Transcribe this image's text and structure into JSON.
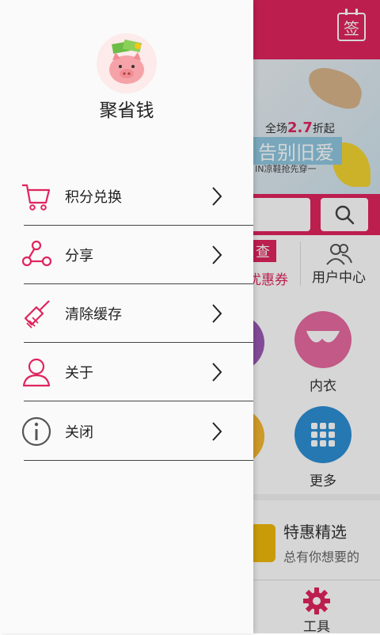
{
  "drawer": {
    "app_name": "聚省钱",
    "menu": [
      {
        "label": "积分兑换",
        "icon": "cart-icon"
      },
      {
        "label": "分享",
        "icon": "share-icon"
      },
      {
        "label": "清除缓存",
        "icon": "broom-icon"
      },
      {
        "label": "关于",
        "icon": "user-icon"
      },
      {
        "label": "关闭",
        "icon": "info-icon"
      }
    ]
  },
  "background": {
    "sign_label": "签",
    "banner": {
      "line1_prefix": "全场",
      "line1_value": "2.7",
      "line1_suffix": "折起",
      "line2": "告别旧爱",
      "line3": "IN凉鞋抢先穿一"
    },
    "quick": {
      "cha": "查",
      "coupon": "优惠券",
      "user_center": "用户中心"
    },
    "categories": {
      "underwear": "内衣",
      "more": "更多"
    },
    "promo": {
      "title": "特惠精选",
      "subtitle": "总有你想要的"
    },
    "tab_tool": "工具"
  },
  "colors": {
    "brand": "#e0245e",
    "purple": "#9b59b6",
    "pink": "#e86aa0",
    "blue": "#2d8fd5",
    "yellow": "#f5b731"
  }
}
